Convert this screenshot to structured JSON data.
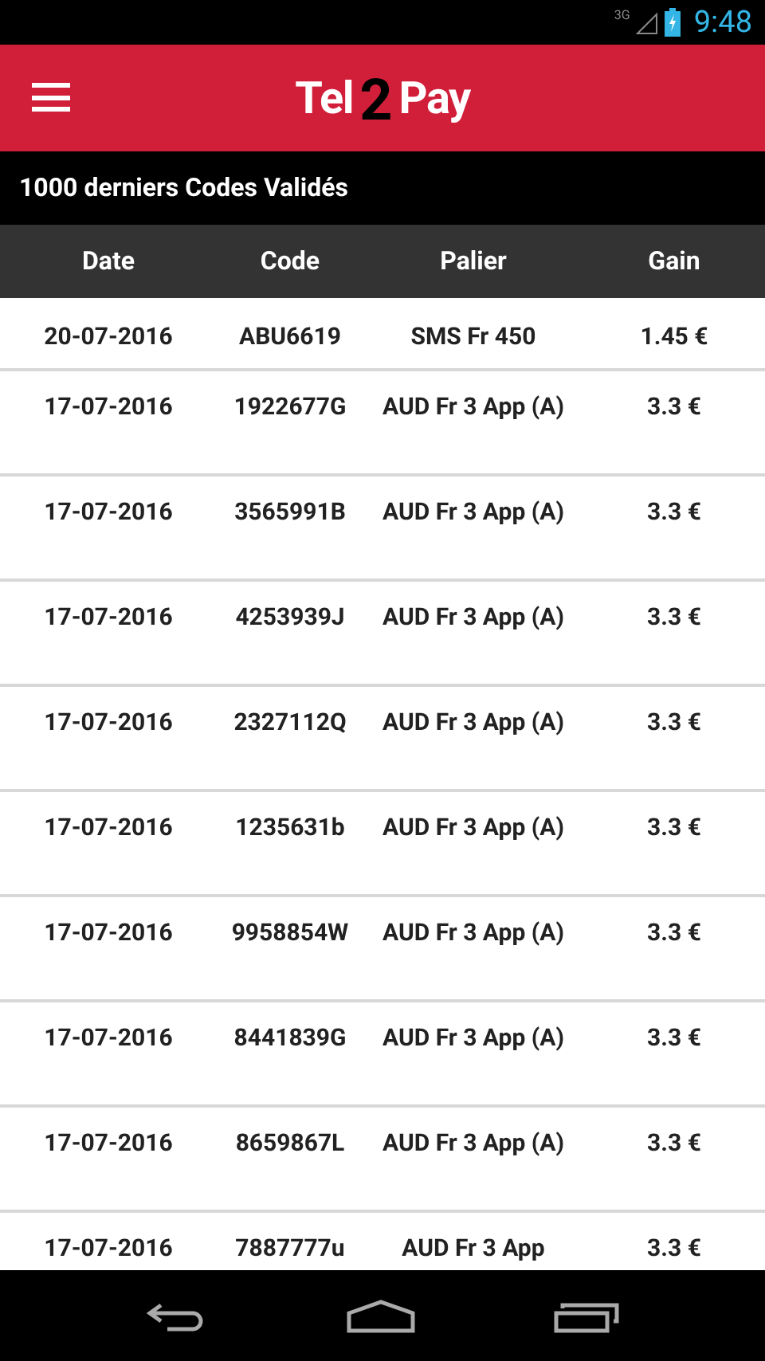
{
  "status_bar": {
    "network": "3G",
    "time": "9:48"
  },
  "logo": {
    "left": "Tel",
    "middle": "2",
    "right": "Pay"
  },
  "title": "1000 derniers Codes Validés",
  "table": {
    "columns": [
      "Date",
      "Code",
      "Palier",
      "Gain"
    ],
    "rows": [
      [
        "20-07-2016",
        "ABU6619",
        "SMS Fr 450",
        "1.45 €"
      ],
      [
        "17-07-2016",
        "1922677G",
        "AUD Fr 3 App (A)",
        "3.3 €"
      ],
      [
        "17-07-2016",
        "3565991B",
        "AUD Fr 3 App (A)",
        "3.3 €"
      ],
      [
        "17-07-2016",
        "4253939J",
        "AUD Fr 3 App (A)",
        "3.3 €"
      ],
      [
        "17-07-2016",
        "2327112Q",
        "AUD Fr 3 App (A)",
        "3.3 €"
      ],
      [
        "17-07-2016",
        "1235631b",
        "AUD Fr 3 App (A)",
        "3.3 €"
      ],
      [
        "17-07-2016",
        "9958854W",
        "AUD Fr 3 App (A)",
        "3.3 €"
      ],
      [
        "17-07-2016",
        "8441839G",
        "AUD Fr 3 App (A)",
        "3.3 €"
      ],
      [
        "17-07-2016",
        "8659867L",
        "AUD Fr 3 App (A)",
        "3.3 €"
      ],
      [
        "17-07-2016",
        "7887777u",
        "AUD Fr 3 App",
        "3.3 €"
      ]
    ]
  }
}
